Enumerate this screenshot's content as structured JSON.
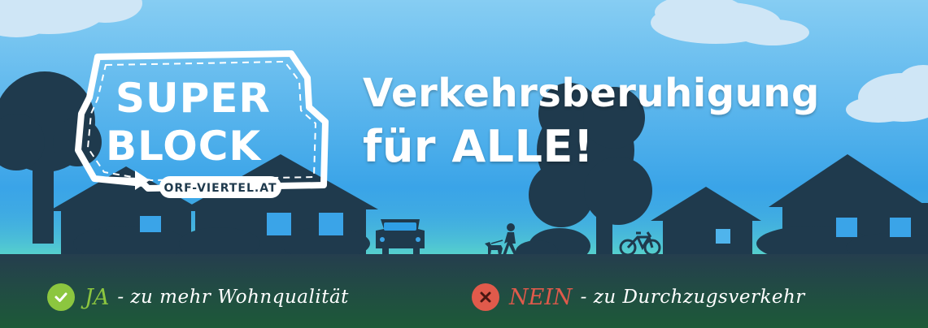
{
  "logo": {
    "line1": "SUPER",
    "line2": "BLOCK",
    "domain": "ORF-VIERTEL.AT"
  },
  "headline": {
    "line1": "Verkehrsberuhigung",
    "line2": "für ALLE!"
  },
  "claims": {
    "yes": {
      "icon": "check-circle-icon",
      "keyword": "JA",
      "text": "- zu mehr Wohnqualität",
      "color": "#8cc63f"
    },
    "no": {
      "icon": "x-circle-icon",
      "keyword": "NEIN",
      "text": "- zu Durchzugsverkehr",
      "color": "#e05a4b"
    }
  },
  "colors": {
    "sky_top": "#7cc8f2",
    "sky_bottom": "#2f9fe6",
    "silhouette": "#1f3a4d",
    "footer_top": "#22424a",
    "footer_bottom": "#1d5a38"
  }
}
